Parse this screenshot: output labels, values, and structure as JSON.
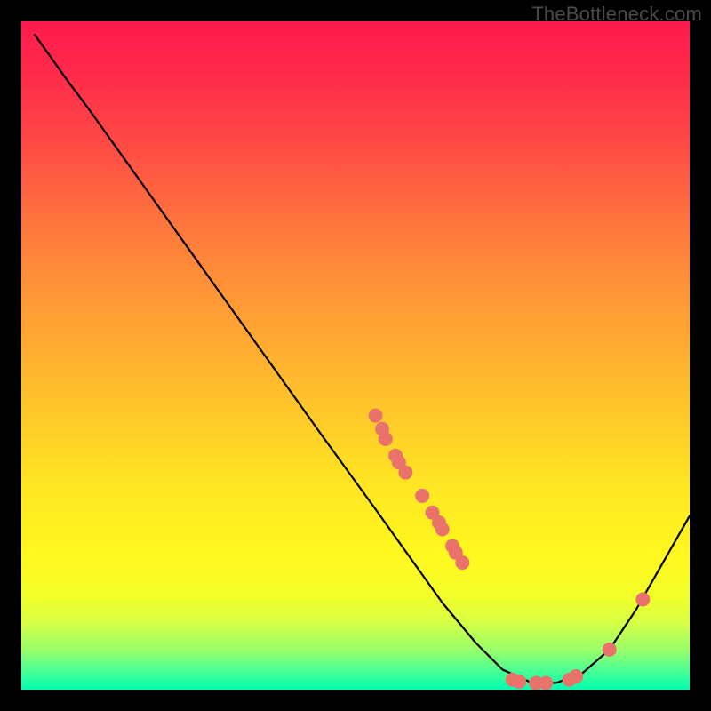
{
  "watermark": "TheBottleneck.com",
  "chart_data": {
    "type": "line",
    "title": "",
    "xlabel": "",
    "ylabel": "",
    "xlim": [
      0,
      100
    ],
    "ylim": [
      0,
      100
    ],
    "curve": [
      {
        "x": 2,
        "y": 98
      },
      {
        "x": 7,
        "y": 91
      },
      {
        "x": 10,
        "y": 87
      },
      {
        "x": 15,
        "y": 80
      },
      {
        "x": 25,
        "y": 66
      },
      {
        "x": 35,
        "y": 52
      },
      {
        "x": 45,
        "y": 38
      },
      {
        "x": 53,
        "y": 27
      },
      {
        "x": 58,
        "y": 20
      },
      {
        "x": 63,
        "y": 13
      },
      {
        "x": 68,
        "y": 7
      },
      {
        "x": 72,
        "y": 3
      },
      {
        "x": 76,
        "y": 1.2
      },
      {
        "x": 80,
        "y": 1
      },
      {
        "x": 84,
        "y": 2.5
      },
      {
        "x": 88,
        "y": 6
      },
      {
        "x": 92,
        "y": 12
      },
      {
        "x": 96,
        "y": 19
      },
      {
        "x": 100,
        "y": 26
      }
    ],
    "points": [
      {
        "x": 53,
        "y": 41
      },
      {
        "x": 54,
        "y": 39
      },
      {
        "x": 54.5,
        "y": 37.5
      },
      {
        "x": 56,
        "y": 35
      },
      {
        "x": 56.5,
        "y": 34
      },
      {
        "x": 57.5,
        "y": 32.5
      },
      {
        "x": 60,
        "y": 29
      },
      {
        "x": 61.5,
        "y": 26.5
      },
      {
        "x": 62.5,
        "y": 25
      },
      {
        "x": 63,
        "y": 24
      },
      {
        "x": 64.5,
        "y": 21.5
      },
      {
        "x": 65,
        "y": 20.5
      },
      {
        "x": 66,
        "y": 19
      },
      {
        "x": 73.5,
        "y": 1.5
      },
      {
        "x": 74.5,
        "y": 1.2
      },
      {
        "x": 77,
        "y": 1
      },
      {
        "x": 78.5,
        "y": 1
      },
      {
        "x": 82,
        "y": 1.5
      },
      {
        "x": 83,
        "y": 2
      },
      {
        "x": 88,
        "y": 6
      },
      {
        "x": 93,
        "y": 13.5
      }
    ],
    "point_color": "#e9736b",
    "point_radius": 8
  }
}
